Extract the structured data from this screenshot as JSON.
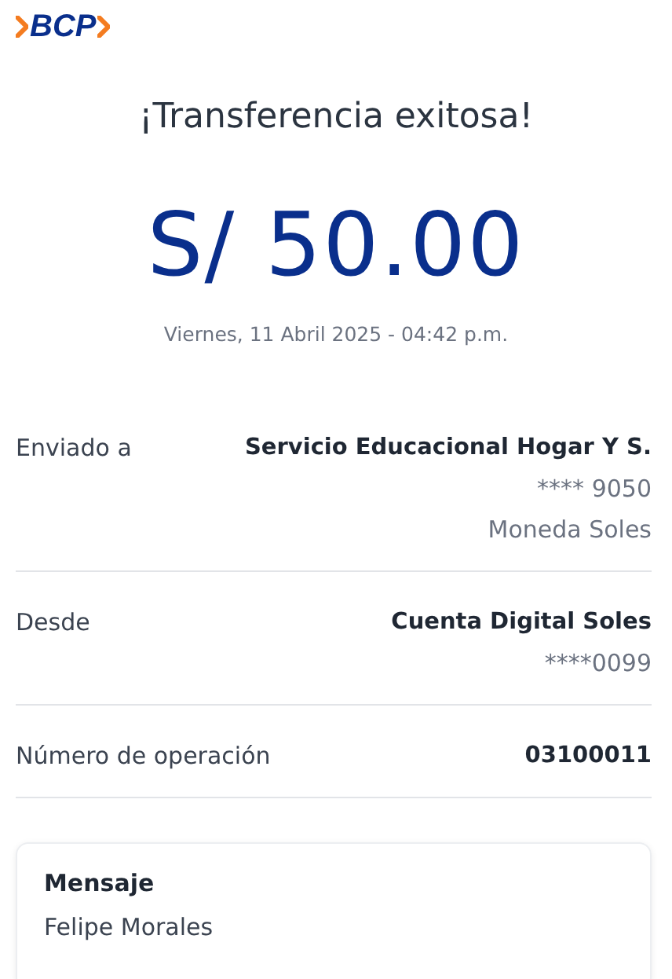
{
  "logo": {
    "text": "BCP"
  },
  "title": "¡Transferencia exitosa!",
  "amount": "S/ 50.00",
  "date": "Viernes, 11 Abril 2025 - 04:42 p.m.",
  "details": [
    {
      "label": "Enviado a",
      "values": [
        "Servicio Educacional Hogar Y S.",
        "**** 9050",
        "Moneda Soles"
      ]
    },
    {
      "label": "Desde",
      "values": [
        "Cuenta Digital Soles",
        "****0099"
      ]
    },
    {
      "label": "Número de operación",
      "values": [
        "03100011"
      ]
    }
  ],
  "message": {
    "heading": "Mensaje",
    "text": "Felipe Morales"
  }
}
